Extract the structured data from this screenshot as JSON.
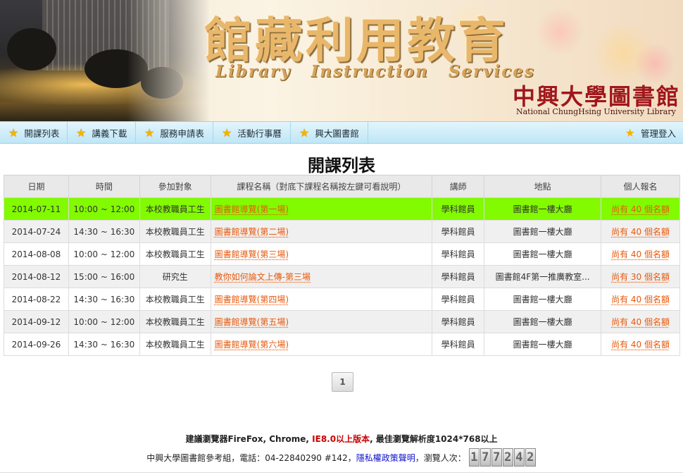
{
  "banner": {
    "title_zh": "館藏利用教育",
    "title_en": "Library Instruction Services",
    "library_zh": "中興大學圖書館",
    "library_en": "National ChungHsing University Library"
  },
  "nav": {
    "items": [
      {
        "label": "開課列表",
        "icon": "star-icon"
      },
      {
        "label": "講義下載",
        "icon": "star-icon"
      },
      {
        "label": "服務申請表",
        "icon": "star-icon"
      },
      {
        "label": "活動行事曆",
        "icon": "star-icon"
      },
      {
        "label": "興大圖書館",
        "icon": "star-icon"
      }
    ],
    "login": {
      "label": "管理登入",
      "icon": "star-icon"
    }
  },
  "page_title": "開課列表",
  "table": {
    "headers": [
      "日期",
      "時間",
      "參加對象",
      "課程名稱（對底下課程名稱按左鍵可看說明）",
      "講師",
      "地點",
      "個人報名"
    ],
    "rows": [
      {
        "date": "2014-07-11",
        "time": "10:00 ~ 12:00",
        "audience": "本校教職員工生",
        "course": "圖書館導覽(第一場)",
        "instructor": "學科館員",
        "location": "圖書館一樓大廳",
        "signup": "尚有 40 個名額",
        "highlight": true
      },
      {
        "date": "2014-07-24",
        "time": "14:30 ~ 16:30",
        "audience": "本校教職員工生",
        "course": "圖書館導覽(第二場)",
        "instructor": "學科館員",
        "location": "圖書館一樓大廳",
        "signup": "尚有 40 個名額"
      },
      {
        "date": "2014-08-08",
        "time": "10:00 ~ 12:00",
        "audience": "本校教職員工生",
        "course": "圖書館導覽(第三場)",
        "instructor": "學科館員",
        "location": "圖書館一樓大廳",
        "signup": "尚有 40 個名額"
      },
      {
        "date": "2014-08-12",
        "time": "15:00 ~ 16:00",
        "audience": "研究生",
        "course": "教你如何論文上傳-第三場",
        "instructor": "學科館員",
        "location": "圖書館4F第一推廣教室...",
        "signup": "尚有 30 個名額"
      },
      {
        "date": "2014-08-22",
        "time": "14:30 ~ 16:30",
        "audience": "本校教職員工生",
        "course": "圖書館導覽(第四場)",
        "instructor": "學科館員",
        "location": "圖書館一樓大廳",
        "signup": "尚有 40 個名額"
      },
      {
        "date": "2014-09-12",
        "time": "10:00 ~ 12:00",
        "audience": "本校教職員工生",
        "course": "圖書館導覽(第五場)",
        "instructor": "學科館員",
        "location": "圖書館一樓大廳",
        "signup": "尚有 40 個名額"
      },
      {
        "date": "2014-09-26",
        "time": "14:30 ~ 16:30",
        "audience": "本校教職員工生",
        "course": "圖書館導覽(第六場)",
        "instructor": "學科館員",
        "location": "圖書館一樓大廳",
        "signup": "尚有 40 個名額"
      }
    ]
  },
  "pager": {
    "current": "1"
  },
  "footer": {
    "browser_prefix": "建議瀏覽器FireFox, Chrome, ",
    "browser_warn": "IE8.0以上版本",
    "browser_suffix": ", 最佳瀏覽解析度1024*768以上",
    "contact_prefix": "中興大學圖書館參考組，電話：04-22840290 #142，",
    "privacy": "隱私權政策聲明",
    "visits_label": "，瀏覽人次：",
    "visit_digits": [
      "1",
      "7",
      "7",
      "2",
      "4",
      "2"
    ]
  },
  "colors": {
    "highlight_row": "#82fa00",
    "link": "#e8590c",
    "nav_bg": "#bfe6f6",
    "star": "#f4b400",
    "library_name": "#a0161b"
  }
}
